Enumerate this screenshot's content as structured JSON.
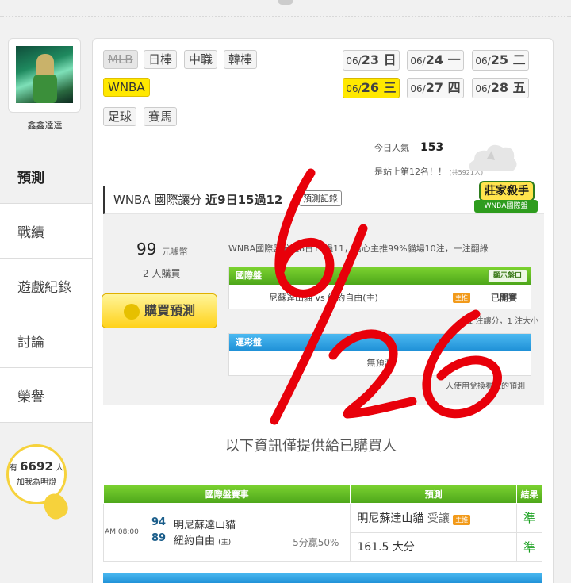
{
  "user": {
    "name": "鑫鑫達達"
  },
  "nav": [
    {
      "label": "預測",
      "active": true
    },
    {
      "label": "戰績"
    },
    {
      "label": "遊戲紀錄"
    },
    {
      "label": "討論"
    },
    {
      "label": "榮譽"
    }
  ],
  "fans": {
    "prefix": "有",
    "count": "6692",
    "suffix": "人",
    "caption": "加我為明燈"
  },
  "sports": [
    "MLB",
    "日棒",
    "中職",
    "韓棒",
    "WNBA",
    "足球",
    "賽馬"
  ],
  "dates": [
    {
      "prefix": "06/",
      "day": "23",
      "weekday": "日"
    },
    {
      "prefix": "06/",
      "day": "24",
      "weekday": "一"
    },
    {
      "prefix": "06/",
      "day": "25",
      "weekday": "二"
    },
    {
      "prefix": "06/",
      "day": "26",
      "weekday": "三",
      "selected": true
    },
    {
      "prefix": "06/",
      "day": "27",
      "weekday": "四"
    },
    {
      "prefix": "06/",
      "day": "28",
      "weekday": "五"
    }
  ],
  "stats": {
    "popularity_label": "今日人氣",
    "popularity_value": "153",
    "rank_text": "是站上第12名！！",
    "rank_total": "(共5921人)"
  },
  "prediction": {
    "title_prefix": "WNBA 國際讓分",
    "title_record": "近9日15過12",
    "record_button": "預測記錄",
    "badge_main": "莊家殺手",
    "badge_sub": "WNBA國際盤",
    "price": "99",
    "price_unit": "元噱幣",
    "buyers": "2 人購買",
    "buy_label": "購買預測",
    "description": "WNBA國際盤分近8日14過11，信心主推99%貓場10注，一注翻綠",
    "intl_header": "國際盤",
    "show_button": "顯示盤口",
    "intl_match": "尼蘇達山貓 vs 紐約自由(主)",
    "intl_tag": "主推",
    "intl_status": "已開賽",
    "intl_note": "1 注讓分，1 注大小",
    "lottery_header": "運彩盤",
    "lottery_empty": "無預測",
    "lottery_note": "人使用兌換看您的預測"
  },
  "info_text": "以下資訊僅提供給已購買人",
  "table": {
    "headers": [
      "國際盤賽事",
      "預測",
      "結果"
    ],
    "rows": [
      {
        "time": "AM 08:00",
        "home_num": "94",
        "home_name": "明尼蘇達山貓",
        "away_num": "89",
        "away_name": "紐約自由",
        "away_mark": "(主)",
        "percent": "5分贏50%",
        "pick1": "明尼蘇達山貓",
        "pick1_type": "受讓",
        "pick1_tag": "主推",
        "pick2": "161.5 大分",
        "result1": "準",
        "result2": "準"
      }
    ]
  },
  "colors": {
    "accent_yellow": "#ffe800",
    "green_header": "#4da61a",
    "blue_header": "#1e8fd6",
    "scribble": "#e8000a"
  }
}
